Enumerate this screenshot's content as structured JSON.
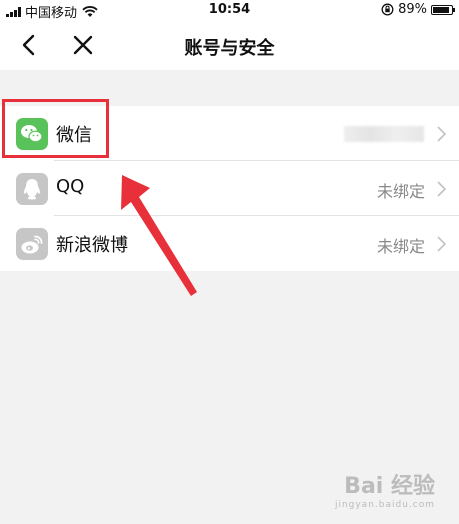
{
  "status_bar": {
    "carrier": "中国移动",
    "time": "10:54",
    "battery": "89%",
    "battery_level": 0.89
  },
  "nav": {
    "title": "账号与安全",
    "back_icon": "chevron-left-icon",
    "close_icon": "close-icon"
  },
  "accounts": [
    {
      "label": "微信",
      "value": "",
      "icon": "wechat-icon",
      "icon_color": "#5ac25a"
    },
    {
      "label": "QQ",
      "value": "未绑定",
      "icon": "qq-icon",
      "icon_color": "#c6c6c6"
    },
    {
      "label": "新浪微博",
      "value": "未绑定",
      "icon": "weibo-icon",
      "icon_color": "#c6c6c6"
    }
  ],
  "annotation": {
    "highlight_color": "#e8303a"
  },
  "watermark": {
    "main": "Bai 经验",
    "sub": "jingyan.baidu.com"
  }
}
